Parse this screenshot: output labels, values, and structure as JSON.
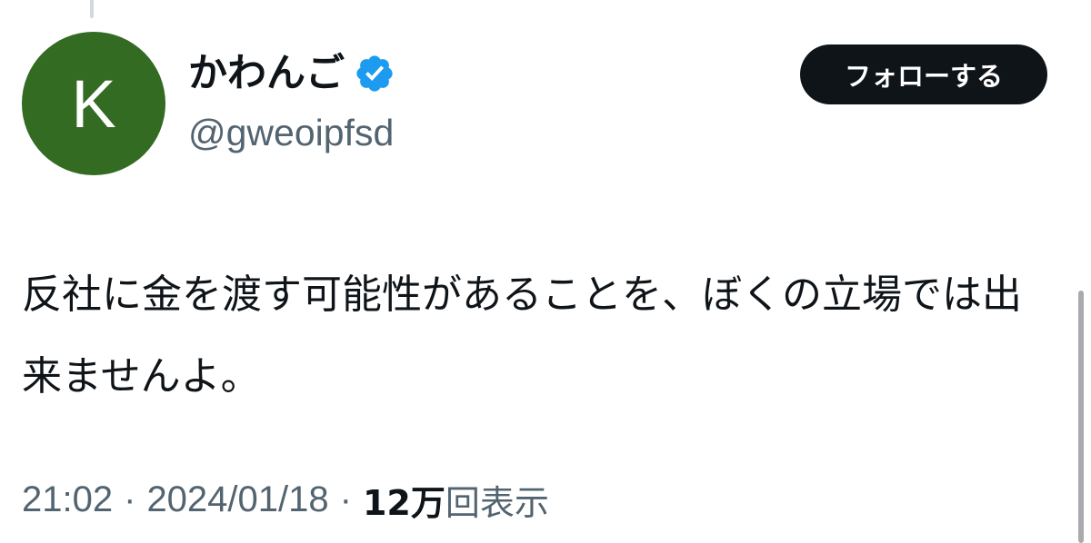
{
  "author": {
    "avatar_letter": "K",
    "avatar_color": "#326b21",
    "display_name": "かわんご",
    "verified": true,
    "verified_icon": "verified-badge-icon",
    "verified_color": "#1d9bf0",
    "handle": "@gweoipfsd"
  },
  "follow_button": {
    "label": "フォローする"
  },
  "tweet": {
    "text": "反社に金を渡す可能性があることを、ぼくの立場では出来ませんよ。"
  },
  "meta": {
    "time": "21:02",
    "separator": "·",
    "date": "2024/01/18",
    "views_count": "12万",
    "views_label": "回表示"
  },
  "colors": {
    "text_primary": "#0f1419",
    "text_secondary": "#536471",
    "button_bg": "#0f1419"
  }
}
